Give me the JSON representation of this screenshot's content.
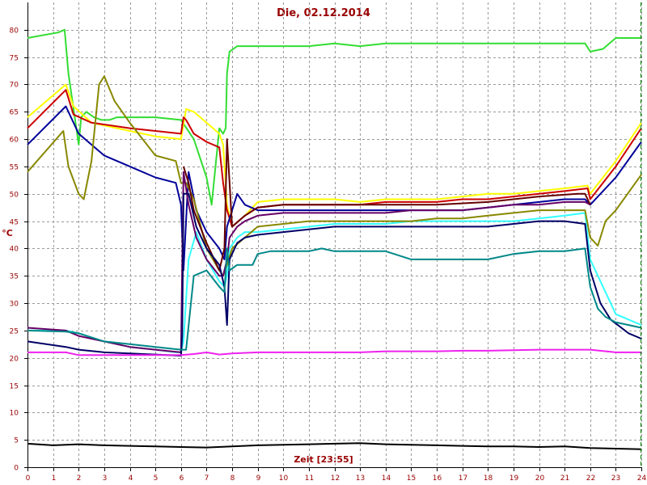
{
  "chart_data": {
    "type": "line",
    "title": "Die, 02.12.2014",
    "ylabel": "°C",
    "xlabel": "Zeit [23:55]",
    "xlim": [
      0,
      24
    ],
    "ylim": [
      0,
      85
    ],
    "xticks": [
      0,
      1,
      2,
      3,
      4,
      5,
      6,
      7,
      8,
      9,
      10,
      11,
      12,
      13,
      14,
      15,
      16,
      17,
      18,
      19,
      20,
      21,
      22,
      23,
      24
    ],
    "yticks": [
      0,
      5,
      10,
      15,
      20,
      25,
      30,
      35,
      40,
      45,
      50,
      55,
      60,
      65,
      70,
      75,
      80
    ],
    "grid": true,
    "colors": {
      "axis": "#000000",
      "grid": "#999999",
      "label": "#990000",
      "marker": "#008000"
    },
    "series": [
      {
        "color": "#33dd33",
        "x": [
          0,
          1.2,
          1.45,
          1.6,
          2.0,
          2.1,
          2.3,
          2.6,
          2.9,
          3.2,
          3.5,
          4,
          5,
          6,
          6.5,
          7.0,
          7.2,
          7.5,
          7.65,
          7.75,
          7.8,
          7.9,
          8.2,
          9,
          11,
          12,
          13,
          14,
          16,
          18,
          20,
          21.5,
          21.8,
          22,
          22.5,
          23,
          24
        ],
        "y": [
          78.5,
          79.5,
          80,
          72,
          59,
          64,
          65,
          64,
          63.5,
          63.5,
          64,
          64,
          64,
          63.5,
          60,
          53,
          48,
          62,
          61,
          62,
          72,
          76,
          77,
          77,
          77,
          77.5,
          77,
          77.5,
          77.5,
          77.5,
          77.5,
          77.5,
          77.5,
          76,
          76.5,
          78.5,
          78.5
        ]
      },
      {
        "color": "#ffff00",
        "x": [
          0,
          1.5,
          1.8,
          2.5,
          4,
          5,
          6,
          6.2,
          6.5,
          7,
          7.5,
          7.65,
          7.8,
          8,
          8.5,
          9,
          10,
          11,
          12,
          13,
          14,
          15,
          16,
          17,
          18,
          19,
          20,
          21,
          21.9,
          22,
          23,
          24
        ],
        "y": [
          64,
          70,
          66,
          63,
          61.5,
          60.5,
          60,
          65.5,
          65,
          63,
          61,
          59,
          48,
          44,
          46,
          48.5,
          49,
          49,
          49,
          48.5,
          49,
          49,
          49,
          49.5,
          50,
          50,
          50.5,
          51,
          51.5,
          50,
          56,
          63
        ]
      },
      {
        "color": "#cc0000",
        "x": [
          0,
          1.5,
          1.8,
          2.5,
          4,
          5,
          6,
          6.1,
          6.2,
          6.5,
          7,
          7.5,
          7.65,
          7.8,
          8,
          8.5,
          9,
          10,
          11,
          12,
          13,
          14,
          15,
          16,
          17,
          18,
          19,
          20,
          21,
          21.9,
          22,
          23,
          24
        ],
        "y": [
          62,
          69,
          64.5,
          63,
          62,
          61.5,
          61,
          64,
          63.5,
          61,
          59.5,
          58.5,
          52,
          47,
          44,
          46,
          47.5,
          48,
          48,
          48,
          48,
          48.5,
          48.5,
          48.5,
          49,
          49,
          49.5,
          50,
          50.5,
          51,
          49,
          55,
          62
        ]
      },
      {
        "color": "#000099",
        "x": [
          0,
          1.5,
          2,
          3,
          4,
          5,
          5.8,
          6,
          6.1,
          6.3,
          6.6,
          7,
          7.5,
          7.7,
          7.8,
          8.0,
          8.2,
          8.5,
          9,
          10,
          11,
          12,
          13,
          14,
          15,
          16,
          17,
          18,
          19,
          20,
          21,
          21.8,
          22,
          23,
          24
        ],
        "y": [
          59,
          66,
          61,
          57,
          55,
          53,
          52,
          48,
          36,
          54,
          47,
          43,
          40,
          38,
          44,
          47,
          50,
          48,
          47,
          47,
          47,
          47,
          47,
          47,
          47,
          47,
          47,
          47.5,
          48,
          48.5,
          49,
          49,
          48,
          53,
          59.5
        ]
      },
      {
        "color": "#33ffff",
        "x": [
          0,
          1.5,
          2,
          3,
          4,
          5,
          5.8,
          6,
          6.1,
          6.3,
          6.6,
          7,
          7.5,
          7.7,
          7.8,
          7.9,
          8.2,
          8.5,
          9,
          10,
          11,
          12,
          13,
          14,
          15,
          16,
          17,
          18,
          19,
          20,
          21,
          21.8,
          22,
          23,
          24
        ],
        "y": [
          25,
          25,
          24.5,
          23,
          22,
          21.5,
          21,
          21,
          23,
          38,
          43,
          38,
          34,
          33,
          35,
          40,
          42,
          43,
          43,
          43.5,
          44,
          44.5,
          44.5,
          44.5,
          45,
          45,
          45,
          45,
          45,
          45.5,
          46,
          46.5,
          38,
          28,
          26
        ]
      },
      {
        "color": "#888800",
        "x": [
          0,
          1.4,
          1.6,
          2.0,
          2.2,
          2.5,
          2.8,
          3.0,
          3.4,
          4,
          5,
          5.8,
          6.0,
          6.2,
          6.5,
          7,
          7.5,
          7.65,
          7.8,
          8.0,
          8.5,
          9,
          10,
          11,
          12,
          13,
          14,
          15,
          16,
          17,
          18,
          19,
          20,
          21,
          21.8,
          22,
          22.3,
          22.6,
          23,
          24
        ],
        "y": [
          54,
          61.5,
          55,
          50,
          49,
          56,
          70,
          71.5,
          67,
          63,
          57,
          56,
          52,
          52,
          49,
          40,
          36,
          35,
          37,
          40,
          42,
          44,
          44.5,
          45,
          45,
          45,
          45,
          45,
          45.5,
          45.5,
          46,
          46.5,
          47,
          47,
          47,
          42,
          40.5,
          45,
          47,
          53.5
        ]
      },
      {
        "color": "#660066",
        "x": [
          0,
          1.5,
          2,
          3,
          4,
          5,
          6,
          6.1,
          6.3,
          6.6,
          7,
          7.5,
          7.65,
          7.8,
          7.9,
          8.2,
          8.5,
          9,
          10,
          11,
          12,
          13,
          14,
          15,
          16,
          17,
          18,
          19,
          20,
          21,
          21.8,
          22
        ],
        "y": [
          25.5,
          25,
          24,
          23,
          22,
          21.5,
          21,
          54,
          48,
          42,
          38,
          35,
          35,
          38,
          42,
          44,
          45,
          46,
          46.5,
          46.5,
          46.5,
          46.5,
          46.5,
          47,
          47,
          47,
          47.5,
          48,
          48,
          48.5,
          48.5,
          48
        ]
      },
      {
        "color": "#660000",
        "x": [
          6.1,
          6.3,
          6.5,
          7,
          7.5,
          7.7,
          7.8,
          8.0,
          8.5,
          9,
          10,
          12,
          14,
          16,
          18,
          20,
          21.5,
          21.8,
          22
        ],
        "y": [
          55,
          52,
          47,
          41,
          36,
          40,
          60,
          44,
          46,
          47.5,
          48,
          48,
          48,
          48,
          48.5,
          49.5,
          50,
          50,
          48
        ]
      },
      {
        "color": "#000066",
        "x": [
          0,
          1.5,
          2,
          3,
          4,
          5,
          6,
          6.05,
          6.1,
          6.3,
          6.6,
          7,
          7.5,
          7.7,
          7.8,
          7.9,
          8.2,
          8.5,
          9,
          10,
          11,
          12,
          13,
          14,
          15,
          16,
          17,
          18,
          19,
          20,
          21,
          21.8,
          22,
          22.4,
          22.8,
          23.5,
          24
        ],
        "y": [
          23,
          22,
          21.5,
          21,
          20.8,
          20.6,
          20.4,
          24,
          50,
          50,
          44,
          40,
          37,
          33,
          26,
          38,
          41,
          42,
          42.5,
          43,
          43.5,
          44,
          44,
          44,
          44,
          44,
          44,
          44,
          44.5,
          45,
          45,
          44.5,
          36,
          30,
          27,
          24.5,
          23.5
        ]
      },
      {
        "color": "#008888",
        "x": [
          0,
          1.5,
          2,
          3,
          4,
          5,
          6,
          6.2,
          6.5,
          7,
          7.5,
          7.7,
          7.8,
          7.9,
          8.2,
          8.5,
          8.8,
          9,
          9.5,
          10,
          11,
          11.5,
          12,
          13,
          14,
          15,
          16,
          17,
          18,
          19,
          20,
          21,
          21.8,
          22,
          22.3,
          22.6,
          23,
          24
        ],
        "y": [
          25,
          24.8,
          24.5,
          23,
          22.5,
          22,
          21.5,
          21.5,
          35,
          36,
          33,
          32,
          40,
          36,
          37,
          37,
          37,
          39,
          39.5,
          39.5,
          39.5,
          40,
          39.5,
          39.5,
          39.5,
          38,
          38,
          38,
          38,
          39,
          39.5,
          39.5,
          40,
          33,
          29,
          27.5,
          26.5,
          25.5
        ]
      },
      {
        "color": "#ee22ee",
        "x": [
          0,
          1.5,
          2,
          3,
          4,
          5,
          6,
          6.5,
          7,
          7.5,
          8,
          9,
          10,
          11,
          12,
          13,
          14,
          15,
          16,
          17,
          18,
          19,
          20,
          21,
          22,
          23,
          24
        ],
        "y": [
          21,
          21,
          20.5,
          20.5,
          20.5,
          20.5,
          20.5,
          20.7,
          21,
          20.6,
          20.8,
          21,
          21,
          21,
          21,
          21,
          21.2,
          21.2,
          21.2,
          21.3,
          21.3,
          21.4,
          21.5,
          21.5,
          21.5,
          21,
          21
        ]
      },
      {
        "color": "#000000",
        "x": [
          0,
          1,
          2,
          3,
          4,
          5,
          6,
          7,
          8,
          9,
          10,
          11,
          12,
          13,
          14,
          15,
          16,
          17,
          18,
          19,
          20,
          21,
          22,
          23,
          24
        ],
        "y": [
          4.3,
          4.0,
          4.2,
          4.0,
          3.9,
          3.8,
          3.7,
          3.6,
          3.8,
          4.0,
          4.1,
          4.2,
          4.3,
          4.4,
          4.2,
          4.1,
          4.0,
          3.9,
          3.8,
          3.8,
          3.7,
          3.8,
          3.5,
          3.4,
          3.3
        ]
      }
    ],
    "markers": [
      {
        "x": 24,
        "color": "#008000"
      }
    ]
  }
}
